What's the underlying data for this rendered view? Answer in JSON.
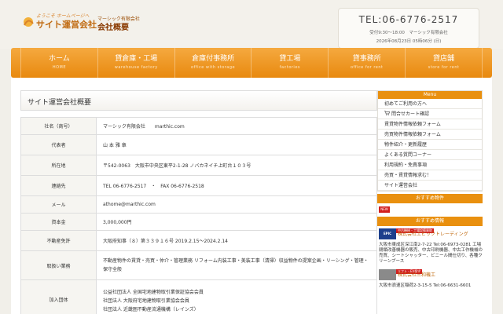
{
  "header": {
    "logo_small": "ようこそ ホームページへ",
    "logo_main": "サイト運営会社",
    "logo_company_small": "マーシック有限会社",
    "logo_company": "会社概要",
    "tel": "TEL:06-6776-2517",
    "hours": "受付9:30〜18:00　マーシック有限会社",
    "date": "2026年08月23日 05時06分 (日)"
  },
  "nav": [
    {
      "jp": "ホーム",
      "en": "HOME"
    },
    {
      "jp": "貸倉庫・工場",
      "en": "warehouse factory"
    },
    {
      "jp": "倉庫付事務所",
      "en": "office with storage"
    },
    {
      "jp": "貸工場",
      "en": "factories"
    },
    {
      "jp": "貸事務所",
      "en": "office for rent"
    },
    {
      "jp": "貸店舗",
      "en": "store for rent"
    }
  ],
  "main": {
    "title": "サイト運営会社概要",
    "rows": [
      {
        "k": "社名（商号）",
        "v": "マーシック有限会社　　marthic.com"
      },
      {
        "k": "代表者",
        "v": "山 本 雅 章"
      },
      {
        "k": "所在地",
        "v": "〒542-0063　大阪市中央区東平2-1-28 ノバカネイチ上町台１０３号"
      },
      {
        "k": "連絡先",
        "v": "TEL 06-6776-2517　・　FAX 06-6776-2518"
      },
      {
        "k": "メール",
        "v": "athome@marthic.com"
      },
      {
        "k": "資本金",
        "v": "3,000,000円"
      },
      {
        "k": "不動産免許",
        "v": "大阪府知事（８）第３３９１６号 2019.2.15〜2024.2.14"
      },
      {
        "k": "取扱い業務",
        "v": "不動産物件の賃貸・売買・仲介・管理業務 リフォーム内装工事・美装工事（清掃）収益物件の提案企画・リーシング・管理・保守全般"
      },
      {
        "k": "加入団体",
        "v1": "公益社団法人 全国宅地建物取引業保証協会会員",
        "v2": "社団法人 大阪府宅地建物取引業協会会員",
        "v3": "社団法人 近畿圏不動産流通機構（レインズ）"
      }
    ]
  },
  "sidebar": {
    "menu_head": "Menu",
    "items": [
      "初めてご利用の方へ",
      "問合せカート確認",
      "賃貸物件情報依頼フォーム",
      "売買物件情報依頼フォーム",
      "物件紹介・更新履歴",
      "よくある質問コーナー",
      "利用規約・免責事項",
      "売買・賃貸情報求む！",
      "サイト運営会社"
    ],
    "recommend_property": "おすすめ物件",
    "new_badge": "NEW",
    "recommend_info": "おすすめ情報",
    "ad1": {
      "logo": "EPIC",
      "tag": "中古機械・工場設備買取",
      "title": "株式会社エピックトレーディング",
      "body": "大阪市東成区深江南2-7-22 Tel:06-6973-0281 工場閉鎖改善機器の販売、中古印刷機器、中古工作機械の売買、シートシャッター、ビニール間仕切り、各種クリーンブース"
    },
    "ad2": {
      "tag": "リフト・EV保守",
      "title": "株式会社三和機工",
      "body": "大阪市浪速区稲荷2-3-15-5 Tel:06-6631-6601"
    },
    "colors": {
      "accent": "#e9900f",
      "brand": "#c06a10",
      "badge": "#d21f1f"
    }
  }
}
